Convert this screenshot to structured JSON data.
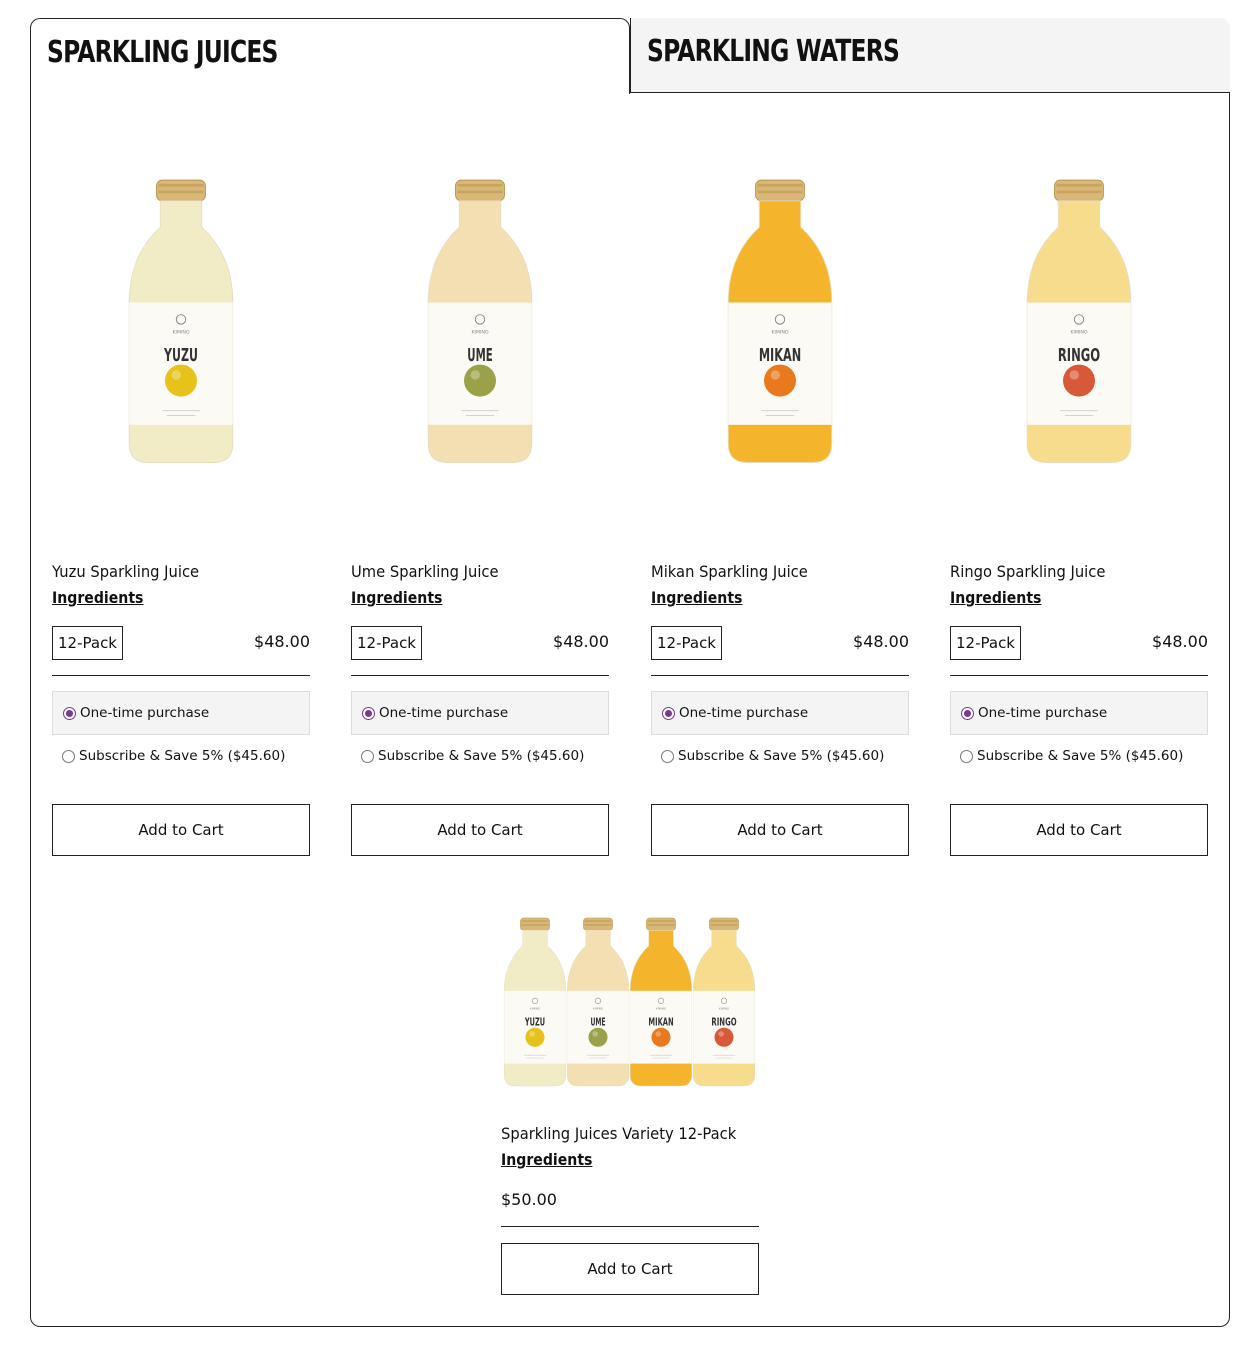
{
  "tabs": [
    {
      "label": "SPARKLING JUICES",
      "active": true
    },
    {
      "label": "SPARKLING WATERS",
      "active": false
    }
  ],
  "products": [
    {
      "name": "Yuzu Sparkling Juice",
      "label_text": "YUZU",
      "brand": "KIMINO",
      "ingredients": "Ingredients",
      "pack": "12-Pack",
      "price": "$48.00",
      "option_one_time": "One-time purchase",
      "option_subscribe": "Subscribe & Save 5% ($45.60)",
      "add_to_cart": "Add to Cart",
      "liquid_color": "#f2ecc6",
      "fruit_color": "#e6c21a"
    },
    {
      "name": "Ume Sparkling Juice",
      "label_text": "UME",
      "brand": "KIMINO",
      "ingredients": "Ingredients",
      "pack": "12-Pack",
      "price": "$48.00",
      "option_one_time": "One-time purchase",
      "option_subscribe": "Subscribe & Save 5% ($45.60)",
      "add_to_cart": "Add to Cart",
      "liquid_color": "#f3dfb2",
      "fruit_color": "#9aa148"
    },
    {
      "name": "Mikan Sparkling Juice",
      "label_text": "MIKAN",
      "brand": "KIMINO",
      "ingredients": "Ingredients",
      "pack": "12-Pack",
      "price": "$48.00",
      "option_one_time": "One-time purchase",
      "option_subscribe": "Subscribe & Save 5% ($45.60)",
      "add_to_cart": "Add to Cart",
      "liquid_color": "#f4b52c",
      "fruit_color": "#e8791d"
    },
    {
      "name": "Ringo Sparkling Juice",
      "label_text": "RINGO",
      "brand": "KIMINO",
      "ingredients": "Ingredients",
      "pack": "12-Pack",
      "price": "$48.00",
      "option_one_time": "One-time purchase",
      "option_subscribe": "Subscribe & Save 5% ($45.60)",
      "add_to_cart": "Add to Cart",
      "liquid_color": "#f6dc8c",
      "fruit_color": "#d8593a"
    }
  ],
  "variety": {
    "name": "Sparkling Juices Variety 12-Pack",
    "ingredients": "Ingredients",
    "price": "$50.00",
    "add_to_cart": "Add to Cart",
    "labels": [
      "YUZU",
      "UME",
      "MIKAN",
      "RINGO"
    ]
  },
  "colors": {
    "accent_radio": "#7a3a8c",
    "border": "#222222",
    "tab_inactive_bg": "#f4f4f4"
  }
}
